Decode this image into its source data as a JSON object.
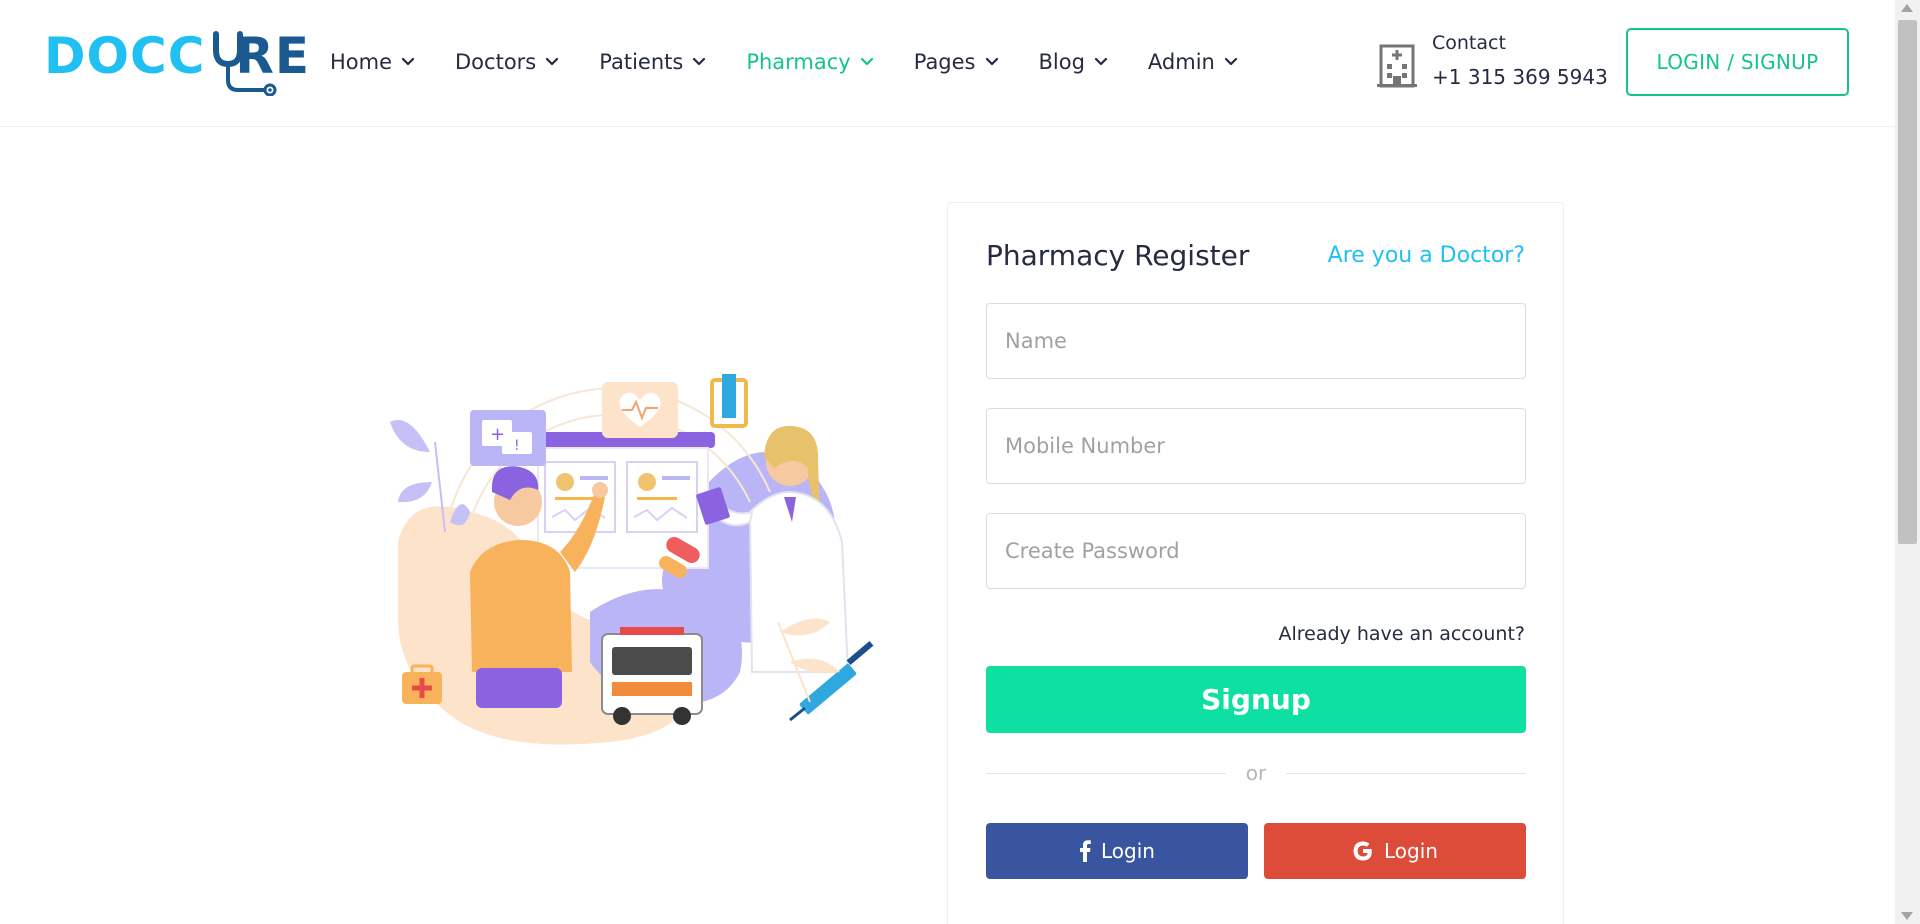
{
  "brand": {
    "logo_part1": "DOCC",
    "logo_part2": "RE",
    "logo_text": "DOCCURE"
  },
  "nav": {
    "items": [
      {
        "label": "Home",
        "active": false
      },
      {
        "label": "Doctors",
        "active": false
      },
      {
        "label": "Patients",
        "active": false
      },
      {
        "label": "Pharmacy",
        "active": true
      },
      {
        "label": "Pages",
        "active": false
      },
      {
        "label": "Blog",
        "active": false
      },
      {
        "label": "Admin",
        "active": false
      }
    ]
  },
  "contact": {
    "label": "Contact",
    "phone": "+1 315 369 5943",
    "icon": "hospital-building-icon"
  },
  "header": {
    "login_signup": "LOGIN / SIGNUP"
  },
  "form": {
    "title": "Pharmacy Register",
    "doctor_link": "Are you a Doctor?",
    "name_placeholder": "Name",
    "mobile_placeholder": "Mobile Number",
    "password_placeholder": "Create Password",
    "already_account": "Already have an account?",
    "signup_label": "Signup",
    "or_label": "or",
    "facebook_login": "Login",
    "google_login": "Login",
    "facebook_icon": "facebook-icon",
    "google_icon": "google-icon"
  },
  "colors": {
    "accent": "#15c38f",
    "signup": "#0de0a2",
    "brand_light": "#20c0f3",
    "brand_dark": "#1b5a90",
    "facebook": "#3a559f",
    "google": "#dd4b39"
  }
}
